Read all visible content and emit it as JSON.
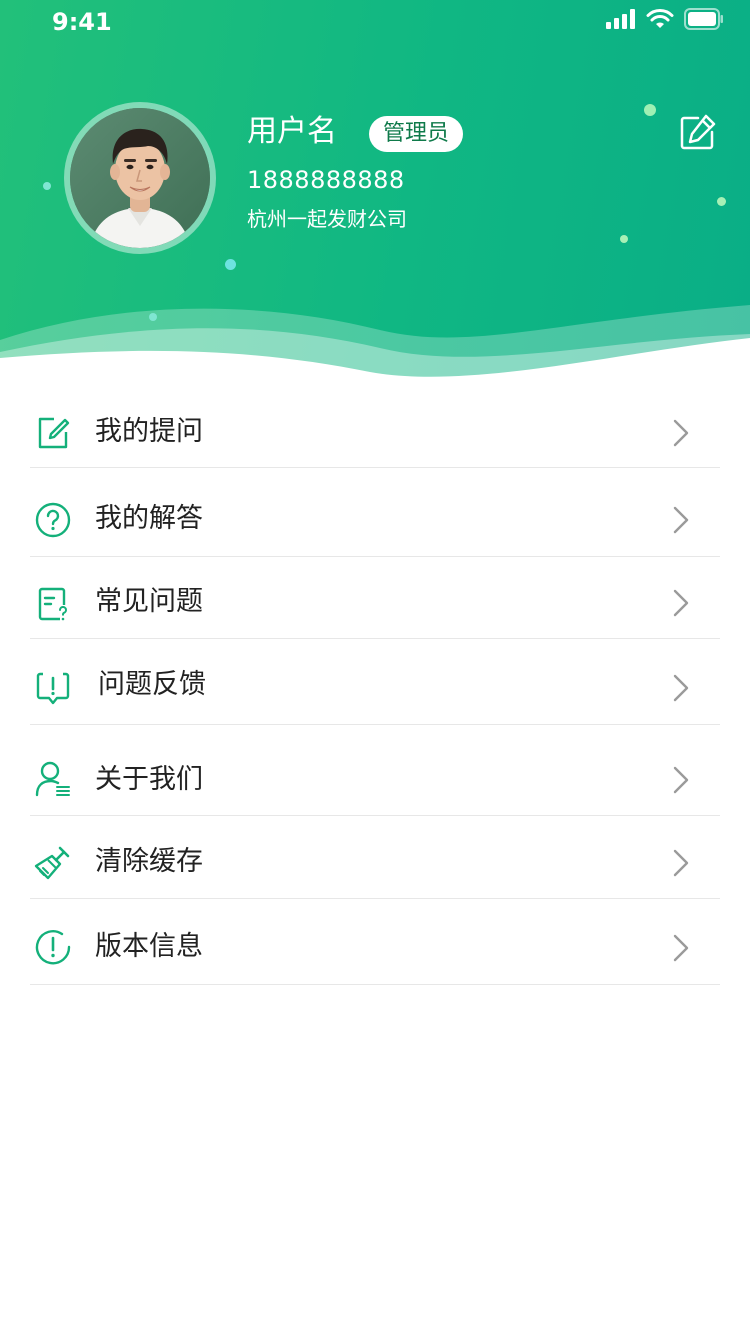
{
  "status_bar": {
    "time": "9:41"
  },
  "profile": {
    "username": "用户名",
    "role": "管理员",
    "phone": "1888888888",
    "company": "杭州一起发财公司"
  },
  "theme": {
    "primary": "#12b57e",
    "icon_stroke": "#14b07a",
    "text": "#222222",
    "chevron": "#9a9a9a",
    "divider": "#e7e7e7"
  },
  "menu": [
    {
      "label": "我的提问",
      "icon": "edit-square-icon"
    },
    {
      "label": "我的解答",
      "icon": "question-circle-icon"
    },
    {
      "label": "常见问题",
      "icon": "document-question-icon"
    },
    {
      "label": "问题反馈",
      "icon": "feedback-bubble-icon"
    },
    {
      "label": "关于我们",
      "icon": "person-list-icon"
    },
    {
      "label": "清除缓存",
      "icon": "broom-icon"
    },
    {
      "label": "版本信息",
      "icon": "info-circle-icon"
    }
  ]
}
